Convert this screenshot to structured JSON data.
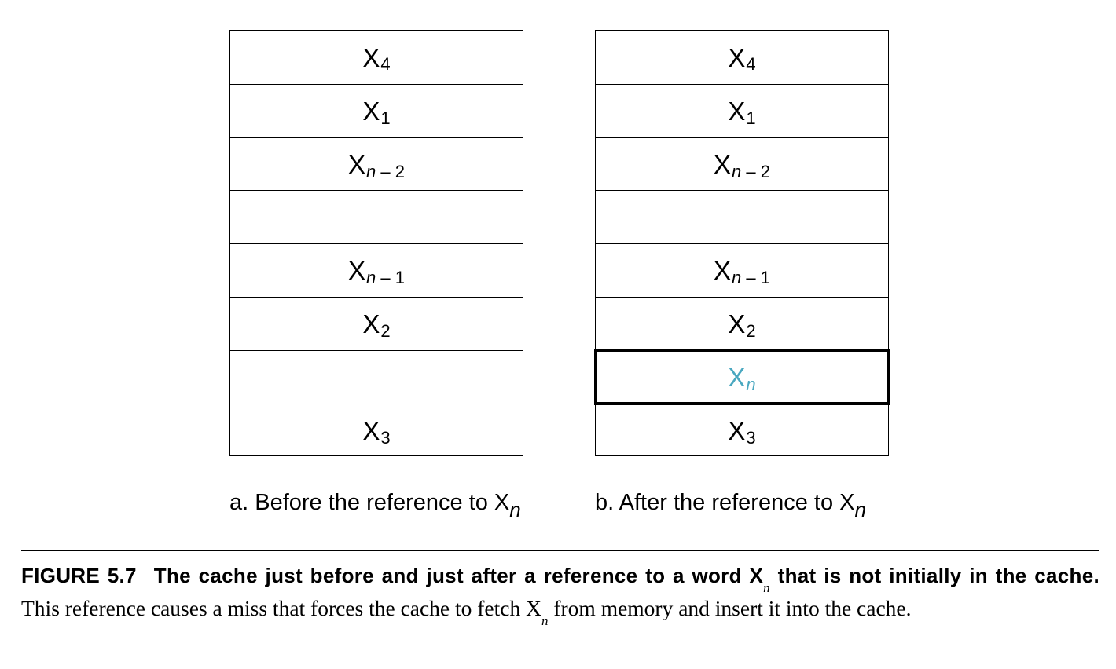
{
  "panel_a": {
    "cells": [
      {
        "main": "X",
        "sub": "4"
      },
      {
        "main": "X",
        "sub": "1"
      },
      {
        "main": "X",
        "sub": "n – 2"
      },
      {
        "main": "",
        "sub": ""
      },
      {
        "main": "X",
        "sub": "n – 1"
      },
      {
        "main": "X",
        "sub": "2"
      },
      {
        "main": "",
        "sub": ""
      },
      {
        "main": "X",
        "sub": "3"
      }
    ],
    "caption": {
      "text": "a. Before the reference to X",
      "sub": "n"
    }
  },
  "panel_b": {
    "cells": [
      {
        "main": "X",
        "sub": "4"
      },
      {
        "main": "X",
        "sub": "1"
      },
      {
        "main": "X",
        "sub": "n – 2"
      },
      {
        "main": "",
        "sub": ""
      },
      {
        "main": "X",
        "sub": "n – 1"
      },
      {
        "main": "X",
        "sub": "2"
      },
      {
        "main": "X",
        "sub": "n",
        "highlight": true
      },
      {
        "main": "X",
        "sub": "3"
      }
    ],
    "caption": {
      "text": "b. After the reference to X",
      "sub": "n"
    }
  },
  "highlight_color": "#4aa8c0",
  "figure_caption": {
    "label": "FIGURE 5.7",
    "bold_part1": "The cache just before and just after a reference to a word X",
    "bold_sub": "n",
    "bold_part2": " that is not initially in the cache.",
    "text_part1": " This reference causes a miss that forces the cache to fetch X",
    "text_sub": "n",
    "text_part2": " from memory and insert it into the cache."
  }
}
